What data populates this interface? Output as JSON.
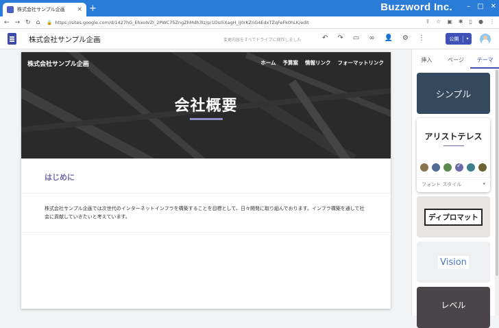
{
  "browser": {
    "tab_title": "株式会社サンプル企画",
    "tab_close": "×",
    "new_tab": "+",
    "brand": "Buzzword Inc.",
    "url": "https://sites.google.com/d/1427hG_EhxoIVZI_2PWC75ZngZhMdh3Iz/p/1DsI5XagH_iJ0rKZnG4EdxTZqFeFk0hLK/edit"
  },
  "sites_toolbar": {
    "site_title": "株式会社サンプル企画",
    "save_status": "変更内容をすべてドライブに保存しました",
    "publish_label": "公開"
  },
  "hero": {
    "site_name": "株式会社サンプル企画",
    "nav": [
      "ホーム",
      "予算案",
      "情報リンク",
      "フォーマットリンク"
    ],
    "title": "会社概要"
  },
  "content": {
    "heading": "はじめに",
    "body": "株式会社サンプル企画では次世代のインターネットインフラを構築することを目標として、日々開発に取り組んでおります。インフラ構築を通して社会に貢献していきたいと考えています。"
  },
  "panel": {
    "tabs": [
      "挿入",
      "ページ",
      "テーマ"
    ],
    "active_tab": "テーマ",
    "themes": {
      "simple": "シンプル",
      "aristotle": "アリストテレス",
      "diplomat": "ディプロマット",
      "vision": "Vision",
      "level": "レベル"
    },
    "font_style_label": "フォント スタイル",
    "swatch_colors": [
      "#8b7550",
      "#4e6e96",
      "#5c8a4e",
      "#6b6ba8",
      "#3d7f8a",
      "#6b6132"
    ],
    "selected_swatch": 3
  },
  "colors": {
    "accent": "#3f51b5",
    "heading": "#6b6ba8",
    "chrome_blue": "#2b7bd8"
  }
}
